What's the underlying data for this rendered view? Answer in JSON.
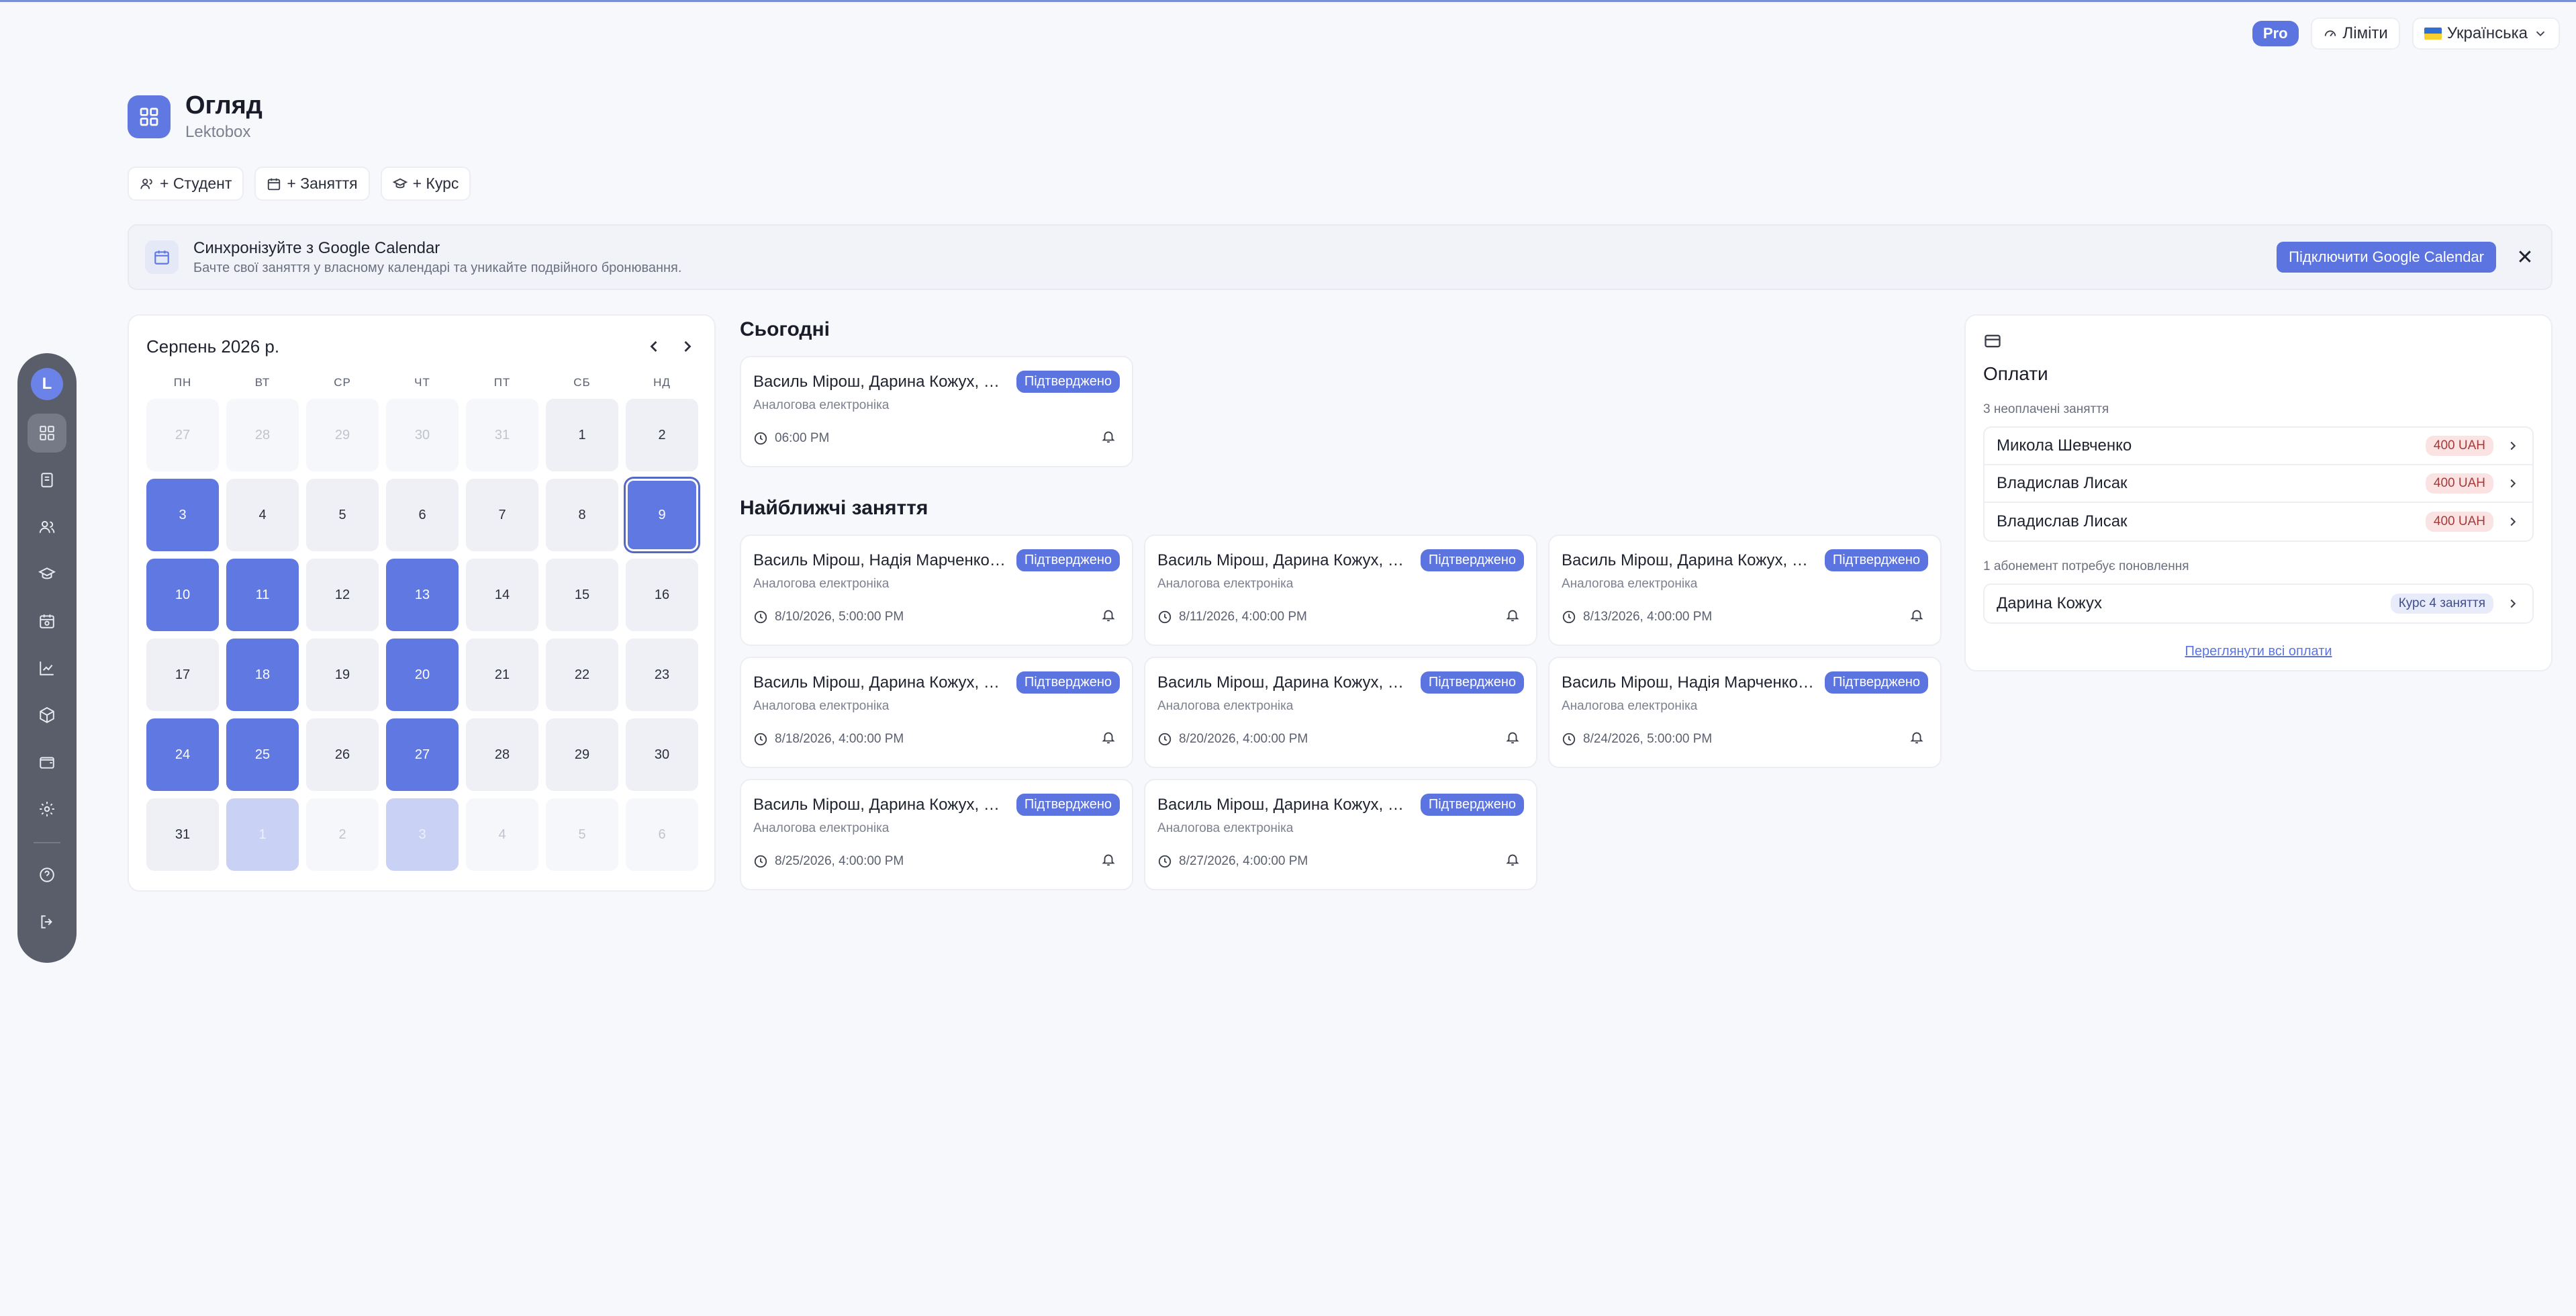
{
  "topbar": {
    "pro": "Pro",
    "limits": "Ліміти",
    "language": "Українська"
  },
  "sidebar": {
    "avatar_letter": "L",
    "items": [
      "overview",
      "journal",
      "students",
      "courses",
      "schedule",
      "analytics",
      "packages",
      "wallet",
      "settings",
      "help",
      "logout"
    ]
  },
  "header": {
    "title": "Огляд",
    "subtitle": "Lektobox"
  },
  "quick_actions": [
    "+ Студент",
    "+ Заняття",
    "+ Курс"
  ],
  "banner": {
    "title": "Синхронізуйте з Google Calendar",
    "text": "Бачте свої заняття у власному календарі та уникайте подвійного бронювання.",
    "button": "Підключити Google Calendar",
    "close": "✕"
  },
  "calendar": {
    "title": "Серпень 2026 р.",
    "weekdays": [
      "ПН",
      "ВТ",
      "СР",
      "ЧТ",
      "ПТ",
      "СБ",
      "НД"
    ],
    "days": [
      {
        "d": "27",
        "s": "out"
      },
      {
        "d": "28",
        "s": "out"
      },
      {
        "d": "29",
        "s": "out"
      },
      {
        "d": "30",
        "s": "out"
      },
      {
        "d": "31",
        "s": "out"
      },
      {
        "d": "1",
        "s": ""
      },
      {
        "d": "2",
        "s": ""
      },
      {
        "d": "3",
        "s": "lesson"
      },
      {
        "d": "4",
        "s": ""
      },
      {
        "d": "5",
        "s": ""
      },
      {
        "d": "6",
        "s": ""
      },
      {
        "d": "7",
        "s": ""
      },
      {
        "d": "8",
        "s": ""
      },
      {
        "d": "9",
        "s": "lesson today"
      },
      {
        "d": "10",
        "s": "lesson"
      },
      {
        "d": "11",
        "s": "lesson"
      },
      {
        "d": "12",
        "s": ""
      },
      {
        "d": "13",
        "s": "lesson"
      },
      {
        "d": "14",
        "s": ""
      },
      {
        "d": "15",
        "s": ""
      },
      {
        "d": "16",
        "s": ""
      },
      {
        "d": "17",
        "s": ""
      },
      {
        "d": "18",
        "s": "lesson"
      },
      {
        "d": "19",
        "s": ""
      },
      {
        "d": "20",
        "s": "lesson"
      },
      {
        "d": "21",
        "s": ""
      },
      {
        "d": "22",
        "s": ""
      },
      {
        "d": "23",
        "s": ""
      },
      {
        "d": "24",
        "s": "lesson"
      },
      {
        "d": "25",
        "s": "lesson"
      },
      {
        "d": "26",
        "s": ""
      },
      {
        "d": "27",
        "s": "lesson"
      },
      {
        "d": "28",
        "s": ""
      },
      {
        "d": "29",
        "s": ""
      },
      {
        "d": "30",
        "s": ""
      },
      {
        "d": "31",
        "s": ""
      },
      {
        "d": "1",
        "s": "lesson-out"
      },
      {
        "d": "2",
        "s": "out"
      },
      {
        "d": "3",
        "s": "lesson-out"
      },
      {
        "d": "4",
        "s": "out"
      },
      {
        "d": "5",
        "s": "out"
      },
      {
        "d": "6",
        "s": "out"
      }
    ]
  },
  "today": {
    "title": "Сьогодні",
    "lesson": {
      "names": "Василь Мірош, Дарина Кожух, Владислав Лисак",
      "badge": "Підтверджено",
      "course": "Аналогова електроніка",
      "time": "06:00 PM"
    }
  },
  "upcoming": {
    "title": "Найближчі заняття",
    "lessons": [
      {
        "names": "Василь Мірош, Надія Марченко, Дарина Кожух",
        "badge": "Підтверджено",
        "course": "Аналогова електроніка",
        "time": "8/10/2026, 5:00:00 PM"
      },
      {
        "names": "Василь Мірош, Дарина Кожух, Владислав Лисак",
        "badge": "Підтверджено",
        "course": "Аналогова електроніка",
        "time": "8/11/2026, 4:00:00 PM"
      },
      {
        "names": "Василь Мірош, Дарина Кожух, Владислав Лисак",
        "badge": "Підтверджено",
        "course": "Аналогова електроніка",
        "time": "8/13/2026, 4:00:00 PM"
      },
      {
        "names": "Василь Мірош, Дарина Кожух, Владислав Лисак",
        "badge": "Підтверджено",
        "course": "Аналогова електроніка",
        "time": "8/18/2026, 4:00:00 PM"
      },
      {
        "names": "Василь Мірош, Дарина Кожух, Владислав Лисак",
        "badge": "Підтверджено",
        "course": "Аналогова електроніка",
        "time": "8/20/2026, 4:00:00 PM"
      },
      {
        "names": "Василь Мірош, Надія Марченко, Дарина Кожух",
        "badge": "Підтверджено",
        "course": "Аналогова електроніка",
        "time": "8/24/2026, 5:00:00 PM"
      },
      {
        "names": "Василь Мірош, Дарина Кожух, Владислав Лисак",
        "badge": "Підтверджено",
        "course": "Аналогова електроніка",
        "time": "8/25/2026, 4:00:00 PM"
      },
      {
        "names": "Василь Мірош, Дарина Кожух, Владислав Лисак",
        "badge": "Підтверджено",
        "course": "Аналогова електроніка",
        "time": "8/27/2026, 4:00:00 PM"
      }
    ]
  },
  "payments": {
    "title": "Оплати",
    "unpaid_label": "3 неоплачені заняття",
    "unpaid": [
      {
        "name": "Микола Шевченко",
        "amount": "400 UAH"
      },
      {
        "name": "Владислав Лисак",
        "amount": "400 UAH"
      },
      {
        "name": "Владислав Лисак",
        "amount": "400 UAH"
      }
    ],
    "renewal_label": "1 абонемент потребує поновлення",
    "renewals": [
      {
        "name": "Дарина Кожух",
        "amount": "Курс 4 заняття"
      }
    ],
    "view_all": "Переглянути всі оплати"
  },
  "colors": {
    "accent": "#5b74e0",
    "lesson_day": "#6079e2",
    "sidebar": "#5a5e6b",
    "unpaid_badge": "#fbe3e3"
  }
}
